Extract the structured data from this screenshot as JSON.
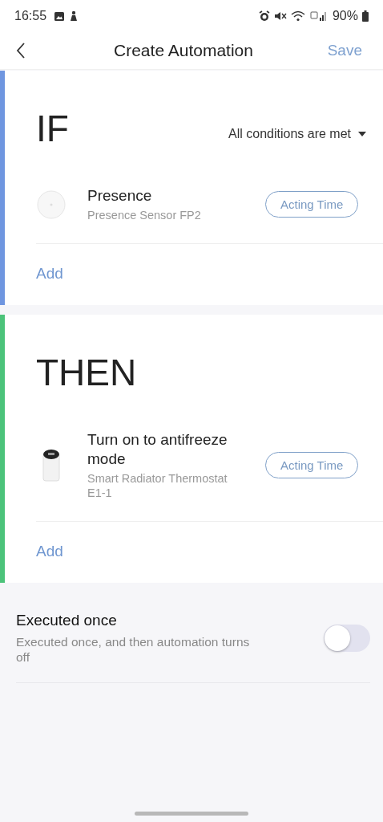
{
  "status_bar": {
    "time": "16:55",
    "battery": "90%"
  },
  "header": {
    "title": "Create Automation",
    "action": "Save"
  },
  "sections": [
    {
      "heading": "IF",
      "color": "#6f96e0",
      "mode": "All conditions are met",
      "items": [
        {
          "kind": "sensor",
          "title": "Presence",
          "subtitle": "Presence Sensor FP2",
          "button": "Acting Time"
        }
      ],
      "add": "Add"
    },
    {
      "heading": "THEN",
      "color": "#4cc37a",
      "items": [
        {
          "kind": "thermostat",
          "title": "Turn on to antifreeze mode",
          "subtitle": "Smart Radiator Thermostat E1-1",
          "button": "Acting Time"
        }
      ],
      "add": "Add"
    }
  ],
  "option": {
    "title": "Executed once",
    "description": "Executed once, and then automation turns off",
    "on": false
  }
}
